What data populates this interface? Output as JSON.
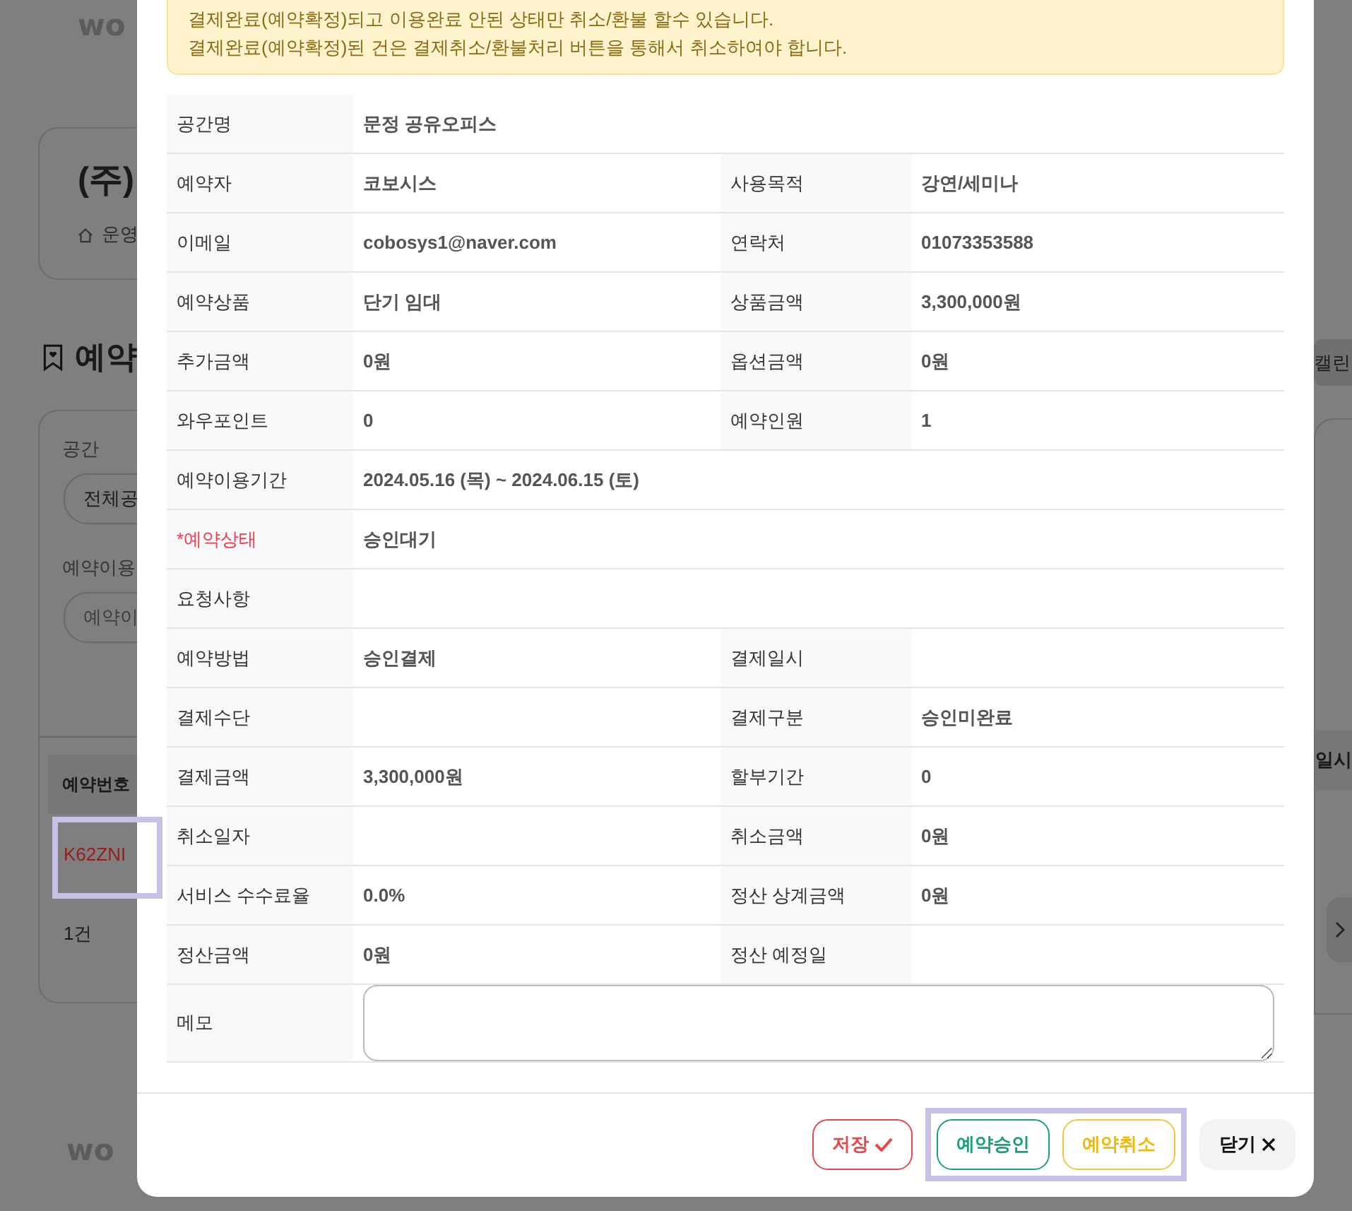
{
  "background": {
    "logo": "wo",
    "company": "(주)",
    "breadcrumb": "운영",
    "section_title": "예약",
    "filters": [
      {
        "label": "공간",
        "value": "전체공"
      },
      {
        "label": "예약이용",
        "placeholder": "예약이"
      }
    ],
    "table_header": "예약번호",
    "row_link": {
      "text": "K62ZNI",
      "highlighted": true
    },
    "count": "1건",
    "calendar_button": "캘린",
    "column_header": "일시",
    "footer_logo": "wo"
  },
  "notice": [
    "결제완료(예약확정)되고 이용완료 안된 상태만 취소/환불 할수 있습니다.",
    "결제완료(예약확정)된 건은 결제취소/환불처리 버튼을 통해서 취소하여야 합니다."
  ],
  "details": [
    {
      "kind": "text",
      "cells": [
        {
          "label": "공간명",
          "value": "문정 공유오피스",
          "required": false
        }
      ]
    },
    {
      "kind": "text",
      "cells": [
        {
          "label": "예약자",
          "value": "코보시스",
          "required": false
        },
        {
          "label": "사용목적",
          "value": "강연/세미나",
          "required": false
        }
      ]
    },
    {
      "kind": "text",
      "cells": [
        {
          "label": "이메일",
          "value": "cobosys1@naver.com",
          "required": false
        },
        {
          "label": "연락처",
          "value": "01073353588",
          "required": false
        }
      ]
    },
    {
      "kind": "text",
      "cells": [
        {
          "label": "예약상품",
          "value": "단기 임대",
          "required": false
        },
        {
          "label": "상품금액",
          "value": "3,300,000원",
          "required": false
        }
      ]
    },
    {
      "kind": "text",
      "cells": [
        {
          "label": "추가금액",
          "value": "0원",
          "required": false
        },
        {
          "label": "옵션금액",
          "value": "0원",
          "required": false
        }
      ]
    },
    {
      "kind": "text",
      "cells": [
        {
          "label": "와우포인트",
          "value": "0",
          "required": false
        },
        {
          "label": "예약인원",
          "value": "1",
          "required": false
        }
      ]
    },
    {
      "kind": "text",
      "cells": [
        {
          "label": "예약이용기간",
          "value": "2024.05.16 (목) ~ 2024.06.15 (토)",
          "required": false
        }
      ]
    },
    {
      "kind": "text",
      "cells": [
        {
          "label": "*예약상태",
          "value": "승인대기",
          "required": true
        }
      ]
    },
    {
      "kind": "text",
      "cells": [
        {
          "label": "요청사항",
          "required": false
        }
      ]
    },
    {
      "kind": "text",
      "cells": [
        {
          "label": "예약방법",
          "value": "승인결제",
          "required": false
        },
        {
          "label": "결제일시",
          "required": false
        }
      ]
    },
    {
      "kind": "text",
      "cells": [
        {
          "label": "결제수단",
          "required": false
        },
        {
          "label": "결제구분",
          "value": "승인미완료",
          "required": false
        }
      ]
    },
    {
      "kind": "text",
      "cells": [
        {
          "label": "결제금액",
          "value": "3,300,000원",
          "required": false
        },
        {
          "label": "할부기간",
          "value": "0",
          "required": false
        }
      ]
    },
    {
      "kind": "text",
      "cells": [
        {
          "label": "취소일자",
          "required": false
        },
        {
          "label": "취소금액",
          "value": "0원",
          "required": false
        }
      ]
    },
    {
      "kind": "text",
      "cells": [
        {
          "label": "서비스 수수료율",
          "value": "0.0%",
          "required": false
        },
        {
          "label": "정산 상계금액",
          "value": "0원",
          "required": false
        }
      ]
    },
    {
      "kind": "text",
      "cells": [
        {
          "label": "정산금액",
          "value": "0원",
          "required": false
        },
        {
          "label": "정산 예정일",
          "required": false
        }
      ]
    },
    {
      "kind": "memo",
      "cells": [
        {
          "label": "메모",
          "required": false
        }
      ]
    }
  ],
  "buttons": [
    {
      "kind": "save",
      "label": "저장",
      "highlighted": false
    },
    {
      "kind": "approve",
      "label": "예약승인",
      "highlighted": true
    },
    {
      "kind": "cancel",
      "label": "예약취소",
      "highlighted": true
    },
    {
      "kind": "close",
      "label": "닫기",
      "highlighted": false
    }
  ]
}
